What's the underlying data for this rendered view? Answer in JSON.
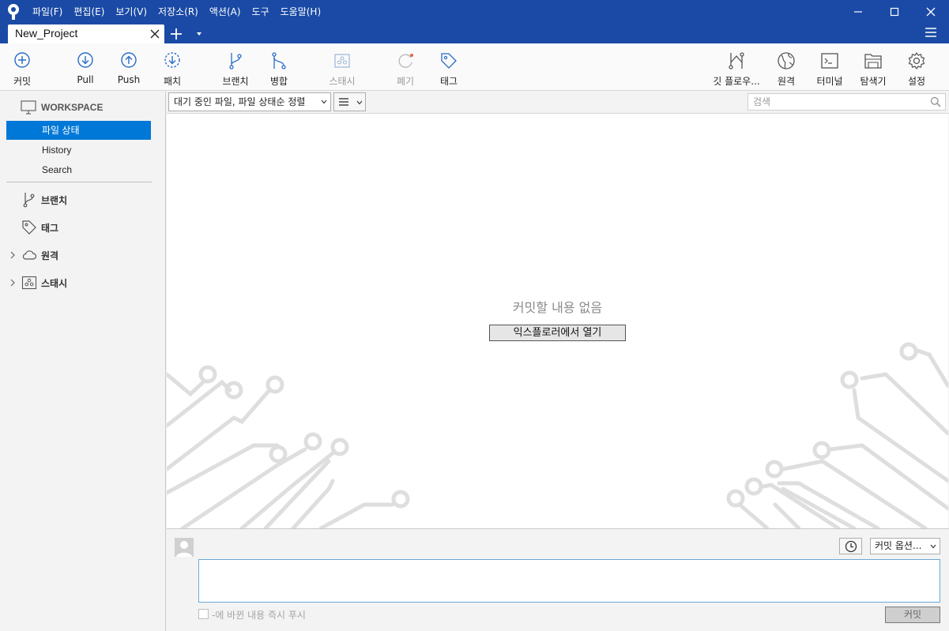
{
  "titlebar": {
    "menu": [
      "파일(F)",
      "편집(E)",
      "보기(V)",
      "저장소(R)",
      "액션(A)",
      "도구",
      "도움말(H)"
    ],
    "tab_label": "New_Project",
    "bg_color": "#1a4aa5"
  },
  "toolbar": {
    "commit": "커밋",
    "pull": "Pull",
    "push": "Push",
    "patch": "패치",
    "branch": "브랜치",
    "merge": "병합",
    "stash": "스태시",
    "discard": "폐기",
    "tag": "태그",
    "git_flow": "깃 플로우...",
    "remote": "원격",
    "terminal": "터미널",
    "explorer": "탐색기",
    "settings": "설정"
  },
  "sidebar": {
    "workspace_title": "WORKSPACE",
    "workspace_items": [
      {
        "label": "파일 상태",
        "active": true
      },
      {
        "label": "History",
        "active": false
      },
      {
        "label": "Search",
        "active": false
      }
    ],
    "groups": [
      {
        "label": "브랜치",
        "icon": "branch-icon"
      },
      {
        "label": "태그",
        "icon": "tag-icon"
      },
      {
        "label": "원격",
        "icon": "cloud-icon"
      },
      {
        "label": "스태시",
        "icon": "stash-icon"
      }
    ],
    "accent_color": "#0078d7"
  },
  "filterbar": {
    "sort_value": "대기 중인 파일, 파일 상태순 정렬",
    "search_placeholder": "검색"
  },
  "main": {
    "empty_message": "커밋할 내용 없음",
    "open_explorer_button": "익스플로러에서 열기"
  },
  "commit": {
    "options_label": "커밋 옵션...",
    "message_value": "",
    "push_label": "-에 바뀐 내용 즉시 푸시",
    "push_checked": false,
    "commit_button": "커밋"
  }
}
